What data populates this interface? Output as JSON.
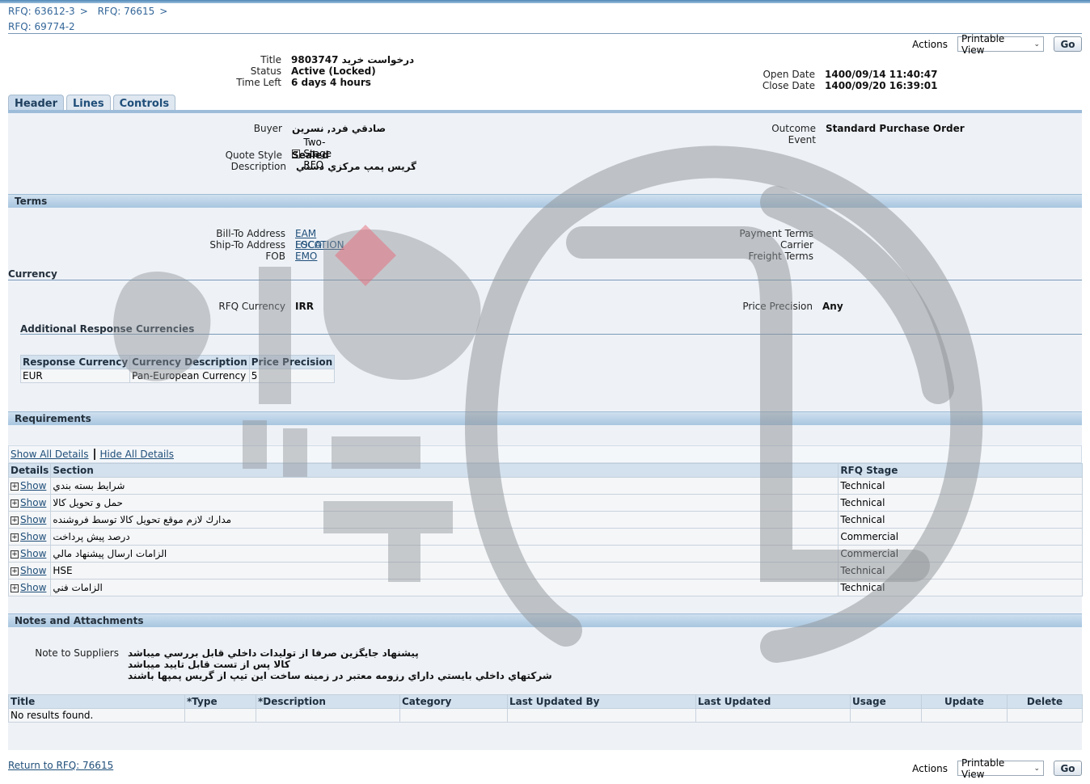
{
  "breadcrumbs": [
    "RFQ: 63612-3",
    "RFQ: 76615"
  ],
  "page_title": "RFQ: 69774-2",
  "actions": {
    "label": "Actions",
    "select_value": "Printable View",
    "go": "Go"
  },
  "summary": {
    "title_label": "Title",
    "title_value": "درخواست خريد 9803747",
    "status_label": "Status",
    "status_value": "Active (Locked)",
    "time_left_label": "Time Left",
    "time_left_value": "6 days 4 hours",
    "open_date_label": "Open Date",
    "open_date_value": "1400/09/14 11:40:47",
    "close_date_label": "Close Date",
    "close_date_value": "1400/09/20 16:39:01"
  },
  "tabs": [
    "Header",
    "Lines",
    "Controls"
  ],
  "header": {
    "buyer_label": "Buyer",
    "buyer_value": "صادقي فرد, نسرين",
    "two_stage_label": "Two-Stage RFQ",
    "quote_style_label": "Quote Style",
    "quote_style_value": "Sealed",
    "description_label": "Description",
    "description_value": "گريس پمپ مرکزي دستي",
    "outcome_label": "Outcome",
    "outcome_value": "Standard Purchase Order",
    "event_label": "Event"
  },
  "terms": {
    "section": "Terms",
    "bill_to_label": "Bill-To Address",
    "bill_to_value": "EAM LOCATION",
    "ship_to_label": "Ship-To Address",
    "ship_to_value": "ESCO EMO",
    "fob_label": "FOB",
    "payment_terms_label": "Payment Terms",
    "carrier_label": "Carrier",
    "freight_terms_label": "Freight Terms"
  },
  "currency": {
    "section": "Currency",
    "rfq_currency_label": "RFQ Currency",
    "rfq_currency_value": "IRR",
    "price_precision_label": "Price Precision",
    "price_precision_value": "Any",
    "additional_title": "Additional Response Currencies",
    "columns": [
      "Response Currency",
      "Currency Description",
      "Price Precision"
    ],
    "rows": [
      [
        "EUR",
        "Pan-European Currency",
        "5"
      ]
    ]
  },
  "requirements": {
    "section": "Requirements",
    "show_all": "Show All Details",
    "hide_all": "Hide All Details",
    "columns": [
      "Details",
      "Section",
      "RFQ Stage"
    ],
    "show_label": "Show",
    "rows": [
      {
        "section": "شرايط بسته بندي",
        "stage": "Technical"
      },
      {
        "section": "حمل و تحويل کالا",
        "stage": "Technical"
      },
      {
        "section": "مدارك لازم موقع تحويل كالا توسط فروشنده",
        "stage": "Technical"
      },
      {
        "section": "درصد پيش پرداخت",
        "stage": "Commercial"
      },
      {
        "section": "الزامات ارسال پيشنهاد مالي",
        "stage": "Commercial"
      },
      {
        "section": "HSE",
        "stage": "Technical"
      },
      {
        "section": "الزامات فني",
        "stage": "Technical"
      }
    ]
  },
  "notes": {
    "section": "Notes and Attachments",
    "note_label": "Note to Suppliers",
    "lines": [
      "پيشنهاد جايگزين صرفا از توليدات داخلي قابل بررسي ميباشد",
      "کالا پس از تست قابل تاييد ميباشد",
      "شرکتهاي داخلي بايستي داراي رزومه معتبر در زمينه ساخت اين تيپ از گريس پمپها باشند"
    ],
    "columns": [
      "Title",
      "*Type",
      "*Description",
      "Category",
      "Last Updated By",
      "Last Updated",
      "Usage",
      "Update",
      "Delete"
    ],
    "empty": "No results found."
  },
  "footer": {
    "return_link": "Return to RFQ: 76615"
  },
  "colors": {
    "accent": "#336699",
    "section_header": "#a8c6e0",
    "content_bg": "#eef2f7"
  }
}
